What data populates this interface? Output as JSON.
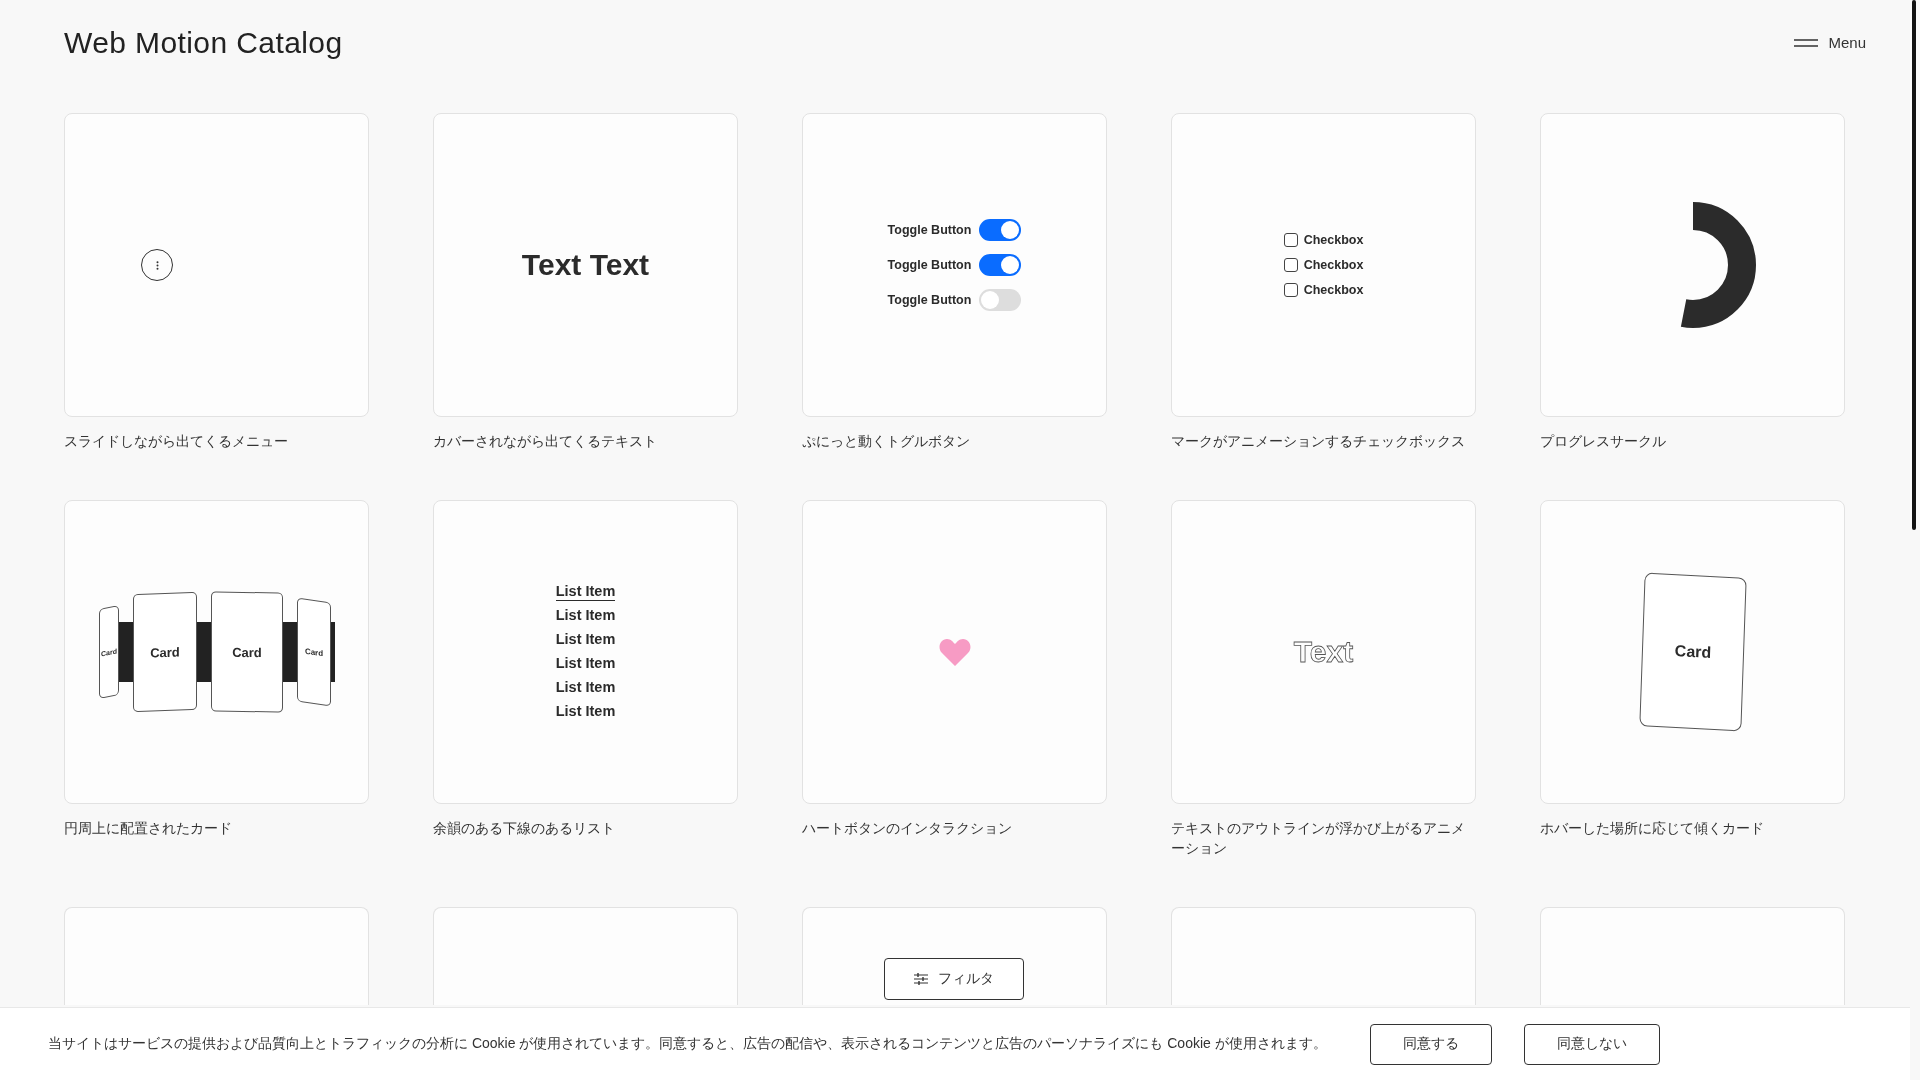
{
  "header": {
    "title": "Web Motion Catalog",
    "menu_label": "Menu"
  },
  "items": [
    {
      "kind": "menu",
      "caption": "スライドしながら出てくるメニュー"
    },
    {
      "kind": "cover_text",
      "text": "Text Text",
      "caption": "カバーされながら出てくるテキスト"
    },
    {
      "kind": "toggles",
      "toggles": [
        {
          "label": "Toggle Button",
          "on": true
        },
        {
          "label": "Toggle Button",
          "on": true
        },
        {
          "label": "Toggle Button",
          "on": false
        }
      ],
      "caption": "ぷにっと動くトグルボタン"
    },
    {
      "kind": "checkboxes",
      "checkboxes": [
        {
          "label": "Checkbox",
          "checked": false
        },
        {
          "label": "Checkbox",
          "checked": false
        },
        {
          "label": "Checkbox",
          "checked": false
        }
      ],
      "caption": "マークがアニメーションするチェックボックス"
    },
    {
      "kind": "progress",
      "level": 0.53,
      "caption": "プログレスサークル"
    },
    {
      "kind": "circle_cards",
      "cards": [
        "Card",
        "Card",
        "Card",
        "Card"
      ],
      "caption": "円周上に配置されたカード"
    },
    {
      "kind": "list",
      "list": [
        {
          "text": "List Item",
          "underlined": true
        },
        {
          "text": "List Item",
          "underlined": false
        },
        {
          "text": "List Item",
          "underlined": false
        },
        {
          "text": "List Item",
          "underlined": false
        },
        {
          "text": "List Item",
          "underlined": false
        },
        {
          "text": "List Item",
          "underlined": false
        }
      ],
      "caption": "余韻のある下線のあるリスト"
    },
    {
      "kind": "heart",
      "color": "#f79bc4",
      "caption": "ハートボタンのインタラクション"
    },
    {
      "kind": "outline_text",
      "text": "Text",
      "caption": "テキストのアウトラインが浮かび上がるアニメーション"
    },
    {
      "kind": "tilt_card",
      "text": "Card",
      "caption": "ホバーした場所に応じて傾くカード"
    },
    {
      "kind": "blank"
    },
    {
      "kind": "blank"
    },
    {
      "kind": "blank"
    },
    {
      "kind": "blank"
    },
    {
      "kind": "blank"
    }
  ],
  "filter_button": "フィルタ",
  "cookie_banner": {
    "text": "当サイトはサービスの提供および品質向上とトラフィックの分析に Cookie が使用されています。同意すると、広告の配信や、表示されるコンテンツと広告のパーソナライズにも Cookie が使用されます。",
    "buttons": [
      "同意する",
      "同意しない"
    ]
  }
}
